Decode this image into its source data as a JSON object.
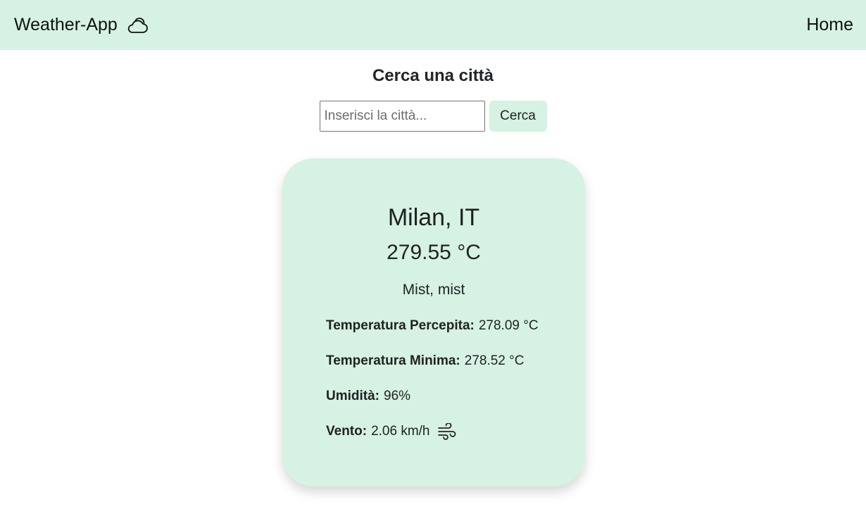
{
  "navbar": {
    "brand": "Weather-App",
    "brand_icon": "cloud-icon",
    "home_link": "Home",
    "background": "#d5f2e3"
  },
  "search": {
    "title": "Cerca una città",
    "placeholder": "Inserisci la città...",
    "value": "",
    "button_label": "Cerca"
  },
  "weather": {
    "city": "Milan, IT",
    "temperature": "279.55 °C",
    "description": "Mist, mist",
    "details": [
      {
        "label": "Temperatura Percepita:",
        "value": "278.09 °C"
      },
      {
        "label": "Temperatura Minima:",
        "value": "278.52 °C"
      },
      {
        "label": "Umidità:",
        "value": "96%"
      },
      {
        "label": "Vento:",
        "value": "2.06 km/h",
        "icon": "wind-icon"
      }
    ]
  }
}
